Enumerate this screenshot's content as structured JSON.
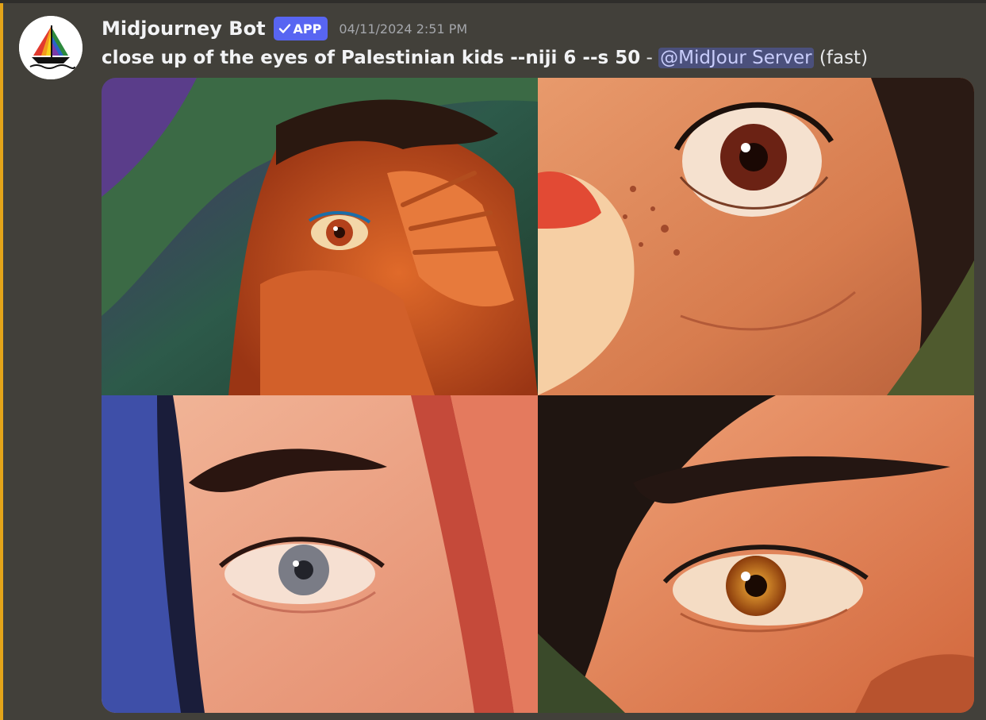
{
  "message": {
    "author": "Midjourney Bot",
    "badge": "APP",
    "timestamp": "04/11/2024 2:51 PM",
    "prompt": "close up of the eyes of Palestinian kids --niji 6 --s 50",
    "separator": " - ",
    "mention": "@MidJour Server",
    "speed": "(fast)"
  },
  "icons": {
    "avatar": "sailboat-logo",
    "badge": "checkmark-icon"
  },
  "colors": {
    "background": "#42403a",
    "accent_bar": "#e3a419",
    "badge": "#5865f2",
    "mention_bg": "#4b507c",
    "mention_text": "#c9cdfb"
  }
}
